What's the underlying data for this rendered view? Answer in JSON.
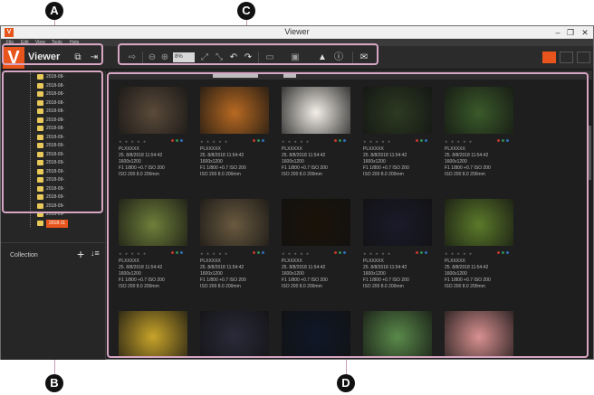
{
  "window": {
    "title": "Viewer",
    "app_icon_letter": "V",
    "controls": [
      "–",
      "❐",
      "✕"
    ]
  },
  "menubar": {
    "items": [
      "File",
      "Edit",
      "View",
      "Tools",
      "Help"
    ]
  },
  "toolbar": {
    "app_name": "Viewer",
    "zoom_value": "8%",
    "accent_color": "#e8551c",
    "icons": [
      "import-icon",
      "zoom-out-icon",
      "zoom-in-icon",
      "fit-icon",
      "actual-size-icon",
      "rotate-left-icon",
      "rotate-right-icon",
      "compare-icon",
      "slideshow-icon",
      "image-edit-icon",
      "info-icon",
      "mail-icon"
    ]
  },
  "sidebar": {
    "folders": [
      "2018-08-",
      "2018-08-",
      "2018-08-",
      "2018-08-",
      "2018-08-",
      "2018-08-",
      "2018-08-",
      "2018-09-",
      "2018-09-",
      "2018-09-",
      "2018-09-",
      "2018-09-",
      "2018-09-",
      "2018-09-",
      "2018-09-",
      "2018-09-",
      "2018-09-",
      "2018-11"
    ],
    "selected_index": 17,
    "collection_label": "Collection",
    "add_icon": "+",
    "sort_icon": "↓≡"
  },
  "grid": {
    "rows": [
      [
        {
          "meta": [
            "PLXXXXX",
            "25. 8/8/2018 11:54:42",
            "1600x1200",
            "F1 1/800 +0.7 ISO 200",
            "ISO 200  8.0  200mm"
          ]
        },
        {
          "meta": [
            "PLXXXXX",
            "25. 8/8/2018 11:54:42",
            "1600x1200",
            "F1 1/800 +0.7 ISO 200",
            "ISO 200  8.0  200mm"
          ]
        },
        {
          "meta": [
            "PLXXXXX",
            "25. 8/8/2018 11:54:42",
            "1600x1200",
            "F1 1/800 +0.7 ISO 200",
            "ISO 200  8.0  200mm"
          ]
        },
        {
          "meta": [
            "PLXXXXX",
            "25. 8/8/2018 11:54:42",
            "1600x1200",
            "F1 1/800 +0.7 ISO 200",
            "ISO 200  8.0  200mm"
          ]
        },
        {
          "meta": [
            "PLXXXXX",
            "25. 8/8/2018 11:54:42",
            "1600x1200",
            "F1 1/800 +0.7 ISO 200",
            "ISO 200  8.0  200mm"
          ]
        }
      ],
      [
        {
          "meta": [
            "PLXXXXX",
            "25. 8/8/2018 11:54:42",
            "1600x1200",
            "F1 1/800 +0.7 ISO 200",
            "ISO 200  8.0  200mm"
          ]
        },
        {
          "meta": [
            "PLXXXXX",
            "25. 8/8/2018 11:54:42",
            "1600x1200",
            "F1 1/800 +0.7 ISO 200",
            "ISO 200  8.0  200mm"
          ]
        },
        {
          "meta": [
            "PLXXXXX",
            "25. 8/8/2018 11:54:42",
            "1600x1200",
            "F1 1/800 +0.7 ISO 200",
            "ISO 200  8.0  200mm"
          ]
        },
        {
          "meta": [
            "PLXXXXX",
            "25. 8/8/2018 11:54:42",
            "1600x1200",
            "F1 1/800 +0.7 ISO 200",
            "ISO 200  8.0  200mm"
          ]
        },
        {
          "meta": [
            "PLXXXXX",
            "25. 8/8/2018 11:54:42",
            "1600x1200",
            "F1 1/800 +0.7 ISO 200",
            "ISO 200  8.0  200mm"
          ]
        }
      ]
    ],
    "thumb_colors": [
      [
        "#5a4a3a",
        "#b86a22",
        "#f3efe8",
        "#2c3a22",
        "#3a5a2a"
      ],
      [
        "#6f7f3a",
        "#6a5a40",
        "#1a1208",
        "#1a1a2a",
        "#5b7a2a"
      ],
      [
        "#c8a42a",
        "#2a2a3a",
        "#101828",
        "#5a8a4a",
        "#d89090"
      ]
    ],
    "stars": "★ ★ ★ ★ ★",
    "label_dot_colors": [
      "#c0392b",
      "#2e8b57",
      "#2f6fb5"
    ]
  },
  "callouts": {
    "A": "A",
    "B": "B",
    "C": "C",
    "D": "D"
  }
}
